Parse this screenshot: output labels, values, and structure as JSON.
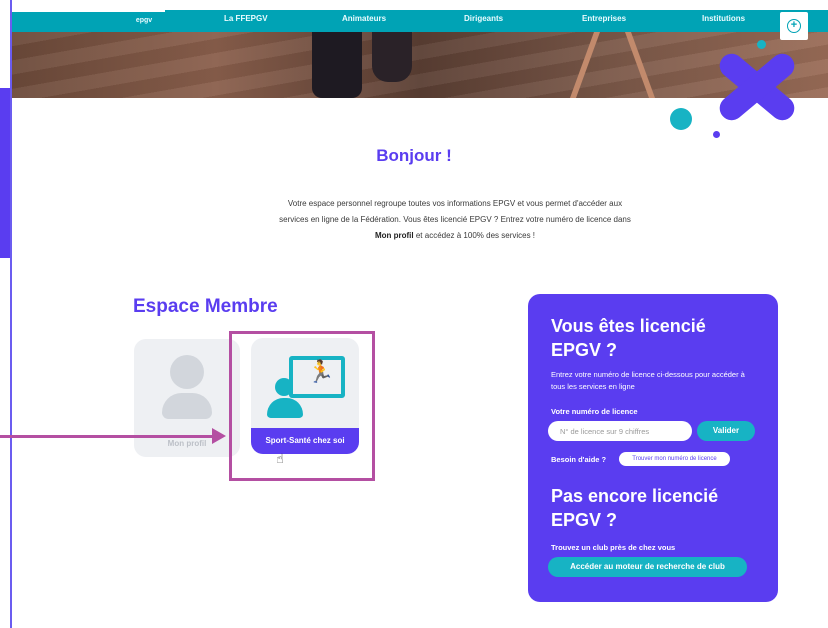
{
  "nav": {
    "logo": "epgv",
    "items": [
      "La FFEPGV",
      "Animateurs",
      "Dirigeants",
      "Entreprises",
      "Institutions"
    ],
    "add_icon": "plus-circle-icon"
  },
  "intro": {
    "greeting": "Bonjour !",
    "line1": "Votre espace personnel regroupe toutes vos informations EPGV et vous permet d'accéder aux",
    "line2": "services en ligne de la Fédération. Vous êtes licencié EPGV ? Entrez votre numéro de licence dans",
    "line3_bold": "Mon profil",
    "line3_rest": " et accédez à 100% des services !"
  },
  "espace": {
    "title": "Espace Membre",
    "cards": [
      {
        "label": "Mon profil",
        "icon": "user-icon"
      },
      {
        "label": "Sport-Santé chez soi",
        "icon": "sport-sante-icon"
      }
    ]
  },
  "panel": {
    "title_licencie": "Vous êtes licencié EPGV ?",
    "desc": "Entrez votre numéro de licence ci-dessous pour accéder à tous les services en ligne",
    "licence_label": "Votre numéro de licence",
    "licence_placeholder": "N° de licence sur 9 chiffres",
    "valider": "Valider",
    "aide_label": "Besoin d'aide ?",
    "aide_link": "Trouver mon numéro de licence",
    "title_pas_licencie": "Pas encore licencié EPGV ?",
    "club_label": "Trouvez un club près de chez vous",
    "club_button": "Accéder au moteur de recherche de club"
  },
  "colors": {
    "brand_purple": "#5a3df0",
    "brand_teal": "#17b3c4",
    "annotation_magenta": "#b44fa2"
  }
}
